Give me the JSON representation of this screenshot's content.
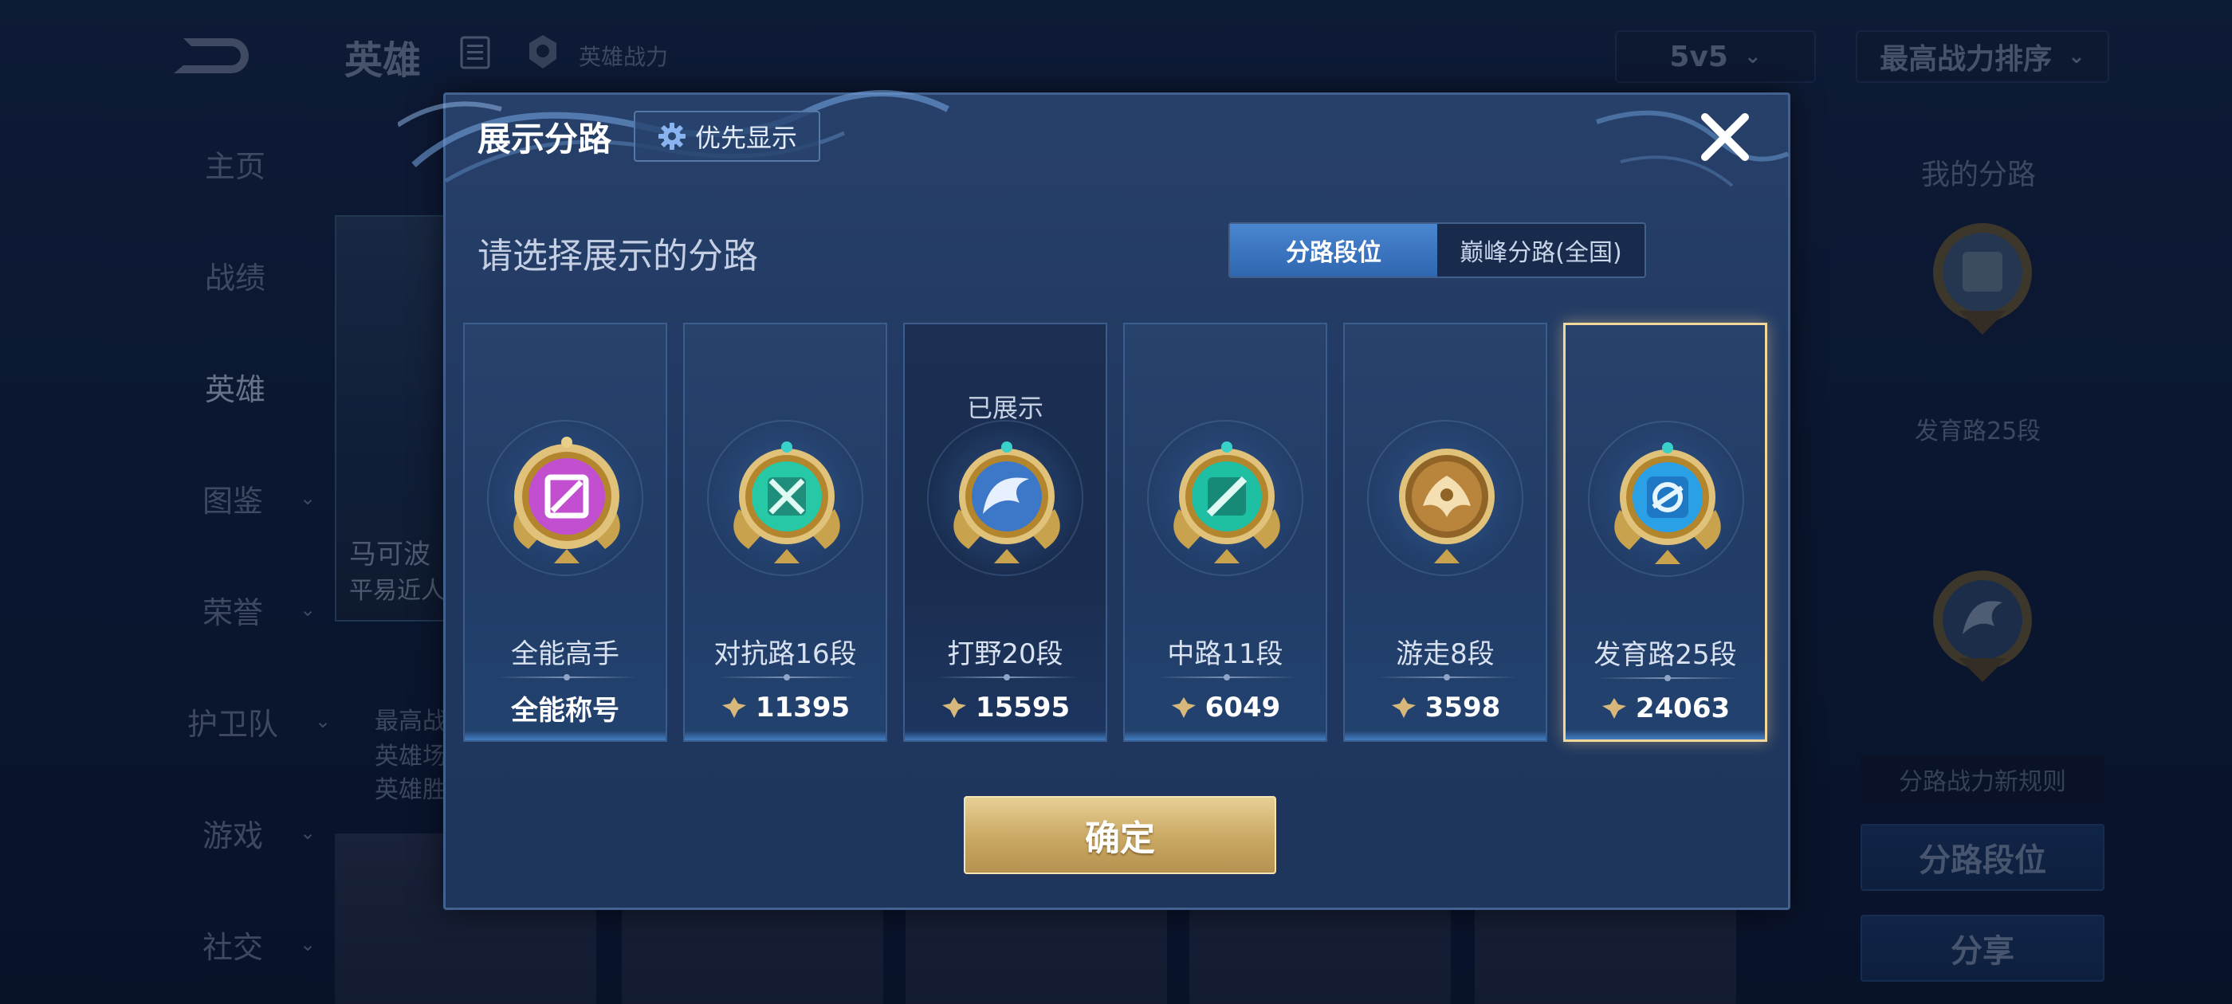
{
  "background": {
    "header": {
      "title": "英雄",
      "power_label": "英雄战力",
      "mode_select": "5v5",
      "sort_select": "最高战力排序"
    },
    "nav": [
      {
        "label": "主页",
        "active": false,
        "has_chevron": false
      },
      {
        "label": "战绩",
        "active": false,
        "has_chevron": false
      },
      {
        "label": "英雄",
        "active": true,
        "has_chevron": false
      },
      {
        "label": "图鉴",
        "active": false,
        "has_chevron": true
      },
      {
        "label": "荣誉",
        "active": false,
        "has_chevron": true
      },
      {
        "label": "护卫队",
        "active": false,
        "has_chevron": true
      },
      {
        "label": "游戏",
        "active": false,
        "has_chevron": true
      },
      {
        "label": "社交",
        "active": false,
        "has_chevron": true
      }
    ],
    "hero_card": {
      "name": "马可波",
      "subtitle": "平易近人",
      "meta_lines": [
        "最高战",
        "英雄场",
        "英雄胜"
      ]
    },
    "right_panel": {
      "title": "我的分路",
      "rank_label": "发育路25段",
      "rules_link": "分路战力新规则",
      "lane_rank_button": "分路段位",
      "share_button": "分享"
    }
  },
  "modal": {
    "title": "展示分路",
    "priority_button": "优先显示",
    "prompt": "请选择展示的分路",
    "segment": {
      "options": [
        "分路段位",
        "巅峰分路(全国)"
      ],
      "active_index": 0
    },
    "cards": [
      {
        "name": "全能高手",
        "value": "全能称号",
        "show_power_icon": false,
        "shown_label": "",
        "selected": false,
        "badge": "all-round-badge",
        "badge_color": "#c24fd0"
      },
      {
        "name": "对抗路16段",
        "value": "11395",
        "show_power_icon": true,
        "shown_label": "",
        "selected": false,
        "badge": "clash-lane-badge",
        "badge_color": "#26c8a6"
      },
      {
        "name": "打野20段",
        "value": "15595",
        "show_power_icon": true,
        "shown_label": "已展示",
        "selected": false,
        "badge": "jungle-badge",
        "badge_color": "#3d78c8"
      },
      {
        "name": "中路11段",
        "value": "6049",
        "show_power_icon": true,
        "shown_label": "",
        "selected": false,
        "badge": "mid-lane-badge",
        "badge_color": "#1fbfa3"
      },
      {
        "name": "游走8段",
        "value": "3598",
        "show_power_icon": true,
        "shown_label": "",
        "selected": false,
        "badge": "roam-badge",
        "badge_color": "#b9843c"
      },
      {
        "name": "发育路25段",
        "value": "24063",
        "show_power_icon": true,
        "shown_label": "",
        "selected": true,
        "badge": "farm-lane-badge",
        "badge_color": "#2aa0e6"
      }
    ],
    "confirm_button": "确定"
  },
  "colors": {
    "accent_gold": "#c9a862",
    "accent_blue": "#3a76c4",
    "selected_border": "#f1d79a"
  }
}
